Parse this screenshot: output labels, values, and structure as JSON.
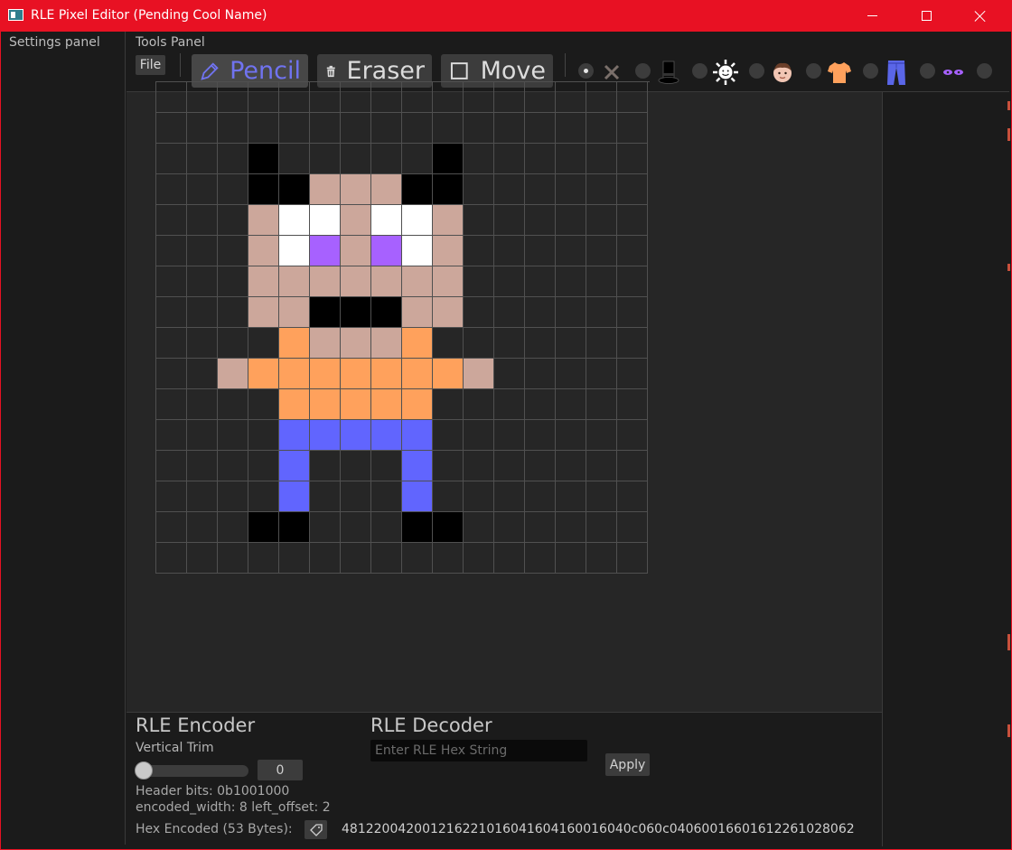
{
  "window": {
    "title": "RLE Pixel Editor (Pending Cool Name)",
    "accent": "#e81123"
  },
  "settings_panel": {
    "heading": "Settings panel"
  },
  "tools_panel": {
    "heading": "Tools Panel",
    "file_label": "File",
    "tools": [
      {
        "label": "Pencil",
        "icon": "pencil-icon",
        "active": true
      },
      {
        "label": "Eraser",
        "icon": "trash-icon",
        "active": false
      },
      {
        "label": "Move",
        "icon": "square-icon",
        "active": false
      }
    ],
    "brushes": [
      {
        "name": "none",
        "icon": "x-icon",
        "selected": true
      },
      {
        "name": "hat",
        "icon": "top-hat-icon",
        "selected": false
      },
      {
        "name": "sun",
        "icon": "sun-icon",
        "selected": false
      },
      {
        "name": "skin",
        "icon": "face-icon",
        "selected": false
      },
      {
        "name": "shirt",
        "icon": "shirt-icon",
        "selected": false
      },
      {
        "name": "pants",
        "icon": "jeans-icon",
        "selected": false
      },
      {
        "name": "eyes",
        "icon": "eyes-icon",
        "selected": false
      },
      {
        "name": "more",
        "icon": "",
        "selected": false
      }
    ]
  },
  "palette": {
    "black": "#000000",
    "white": "#ffffff",
    "skin": "#cca79b",
    "purple": "#a761ff",
    "orange": "#ffa15c",
    "blue": "#6165fe"
  },
  "canvas": {
    "columns": 16,
    "rows": 16,
    "pixels": [
      "................",
      "................",
      "...K.....K......",
      "...KKSSSKK......",
      "...SWWSWWS......",
      "...SWPSPWS......",
      "...SSSSSSS......",
      "...SSKKKSS......",
      "....OSSSO.......",
      "..SOOOOOOOS.....",
      "....OOOOO.......",
      "....BBBBB.......",
      "....B...B.......",
      "....B...B.......",
      "...KK...KK......",
      "................"
    ]
  },
  "encoder": {
    "heading": "RLE Encoder",
    "trim_label": "Vertical Trim",
    "trim_value": "0",
    "trim_fraction": 0,
    "header_bits": "Header bits: 0b1001000",
    "encoded_info": "encoded_width: 8 left_offset: 2",
    "hex_label": "Hex Encoded (53 Bytes):",
    "hex_value": "48122004200121622101604160416001604 0c060c0406001660161226102806 2"
  },
  "decoder": {
    "heading": "RLE Decoder",
    "placeholder": "Enter RLE Hex String",
    "apply_label": "Apply"
  }
}
